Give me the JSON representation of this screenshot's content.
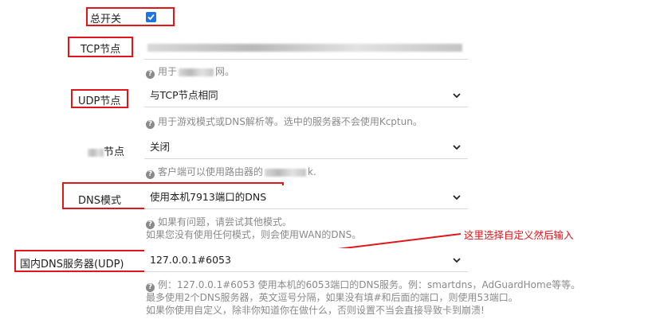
{
  "master_switch": {
    "label": "总开关",
    "checked": true
  },
  "tcp_node": {
    "label": "TCP节点",
    "help": "用于",
    "help_suffix": "网。"
  },
  "udp_node": {
    "label": "UDP节点",
    "value": "与TCP节点相同",
    "help": "用于游戏模式或DNS解析等。选中的服务器不会使用Kcptun。"
  },
  "third_node": {
    "label_suffix": "节点",
    "value": "关闭",
    "help": "客户端可以使用路由器的",
    "help_suffix": "k."
  },
  "dns_mode": {
    "label": "DNS模式",
    "value": "使用本机7913端口的DNS",
    "help_line1": "如果有问题，请尝试其他模式。",
    "help_line2": "如果您没有使用任何模式，则会使用WAN的DNS。"
  },
  "domestic_dns": {
    "label": "国内DNS服务器(UDP)",
    "value": "127.0.0.1#6053",
    "help_line1": "例：127.0.0.1#6053 使用本机的6053端口的DNS服务。例：smartdns，AdGuardHome等等。",
    "help_line2": "最多使用2个DNS服务器，英文逗号分隔，如果没有填#和后面的端口，则使用53端口。",
    "help_line3": "如果你使用自定义，除非你知道你在做什么，否则设置不当会直接导致卡到崩溃!"
  },
  "annotation": {
    "text": "这里选择自定义然后输入"
  },
  "colors": {
    "highlight": "#e0161b",
    "checkbox": "#1a73e8",
    "help_text": "#8a8a8a"
  }
}
